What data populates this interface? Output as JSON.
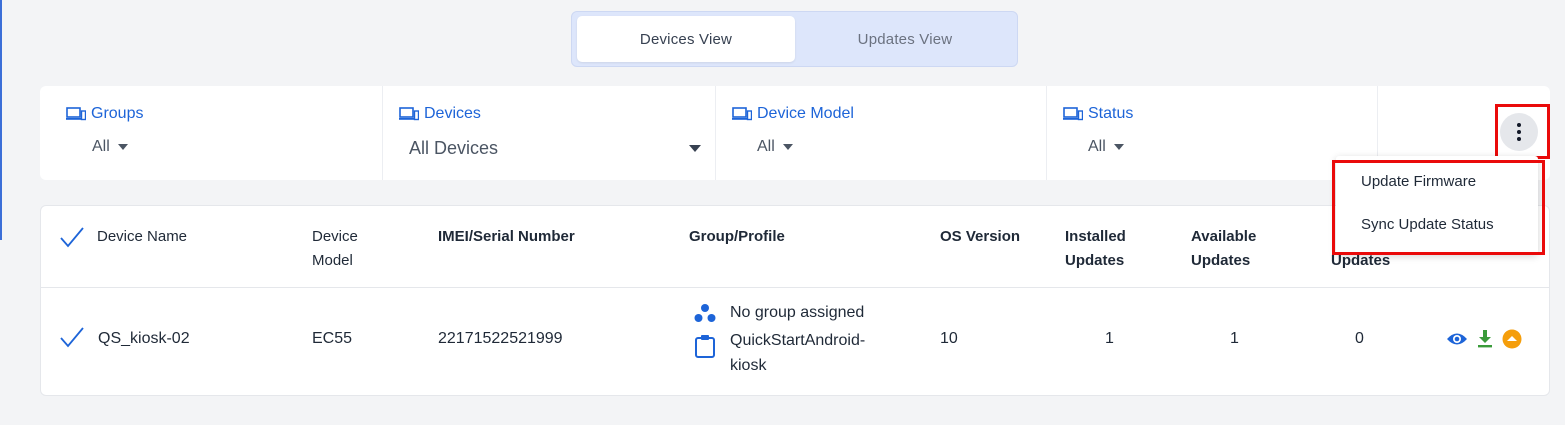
{
  "view_switcher": {
    "tabs": [
      {
        "label": "Devices View",
        "active": true
      },
      {
        "label": "Updates View",
        "active": false
      }
    ]
  },
  "filters": [
    {
      "label": "Groups",
      "value": "All",
      "icon": "devices-icon"
    },
    {
      "label": "Devices",
      "value": "All Devices",
      "icon": "devices-icon"
    },
    {
      "label": "Device Model",
      "value": "All",
      "icon": "devices-icon"
    },
    {
      "label": "Status",
      "value": "All",
      "icon": "devices-icon"
    }
  ],
  "table": {
    "columns": {
      "device_name": "Device Name",
      "device_model": [
        "Device",
        "Model"
      ],
      "imei": "IMEI/Serial Number",
      "group_profile": "Group/Profile",
      "os_version": "OS Version",
      "installed": [
        "Installed",
        "Updates"
      ],
      "available": [
        "Available",
        "Updates"
      ],
      "pending": "Updates"
    },
    "rows": [
      {
        "device_name": "QS_kiosk-02",
        "device_model": "EC55",
        "imei": "22171522521999",
        "group": "No group assigned",
        "profile": [
          "QuickStartAndroid-",
          "kiosk"
        ],
        "os_version": "10",
        "installed": "1",
        "available": "1",
        "pending": "0"
      }
    ]
  },
  "menu": {
    "items": [
      "Update Firmware",
      "Sync Update Status"
    ]
  },
  "colors": {
    "accent": "#1d64d8",
    "highlight": "#ea0a0a",
    "download": "#3a9b3a",
    "upgrade": "#f59e0b"
  }
}
